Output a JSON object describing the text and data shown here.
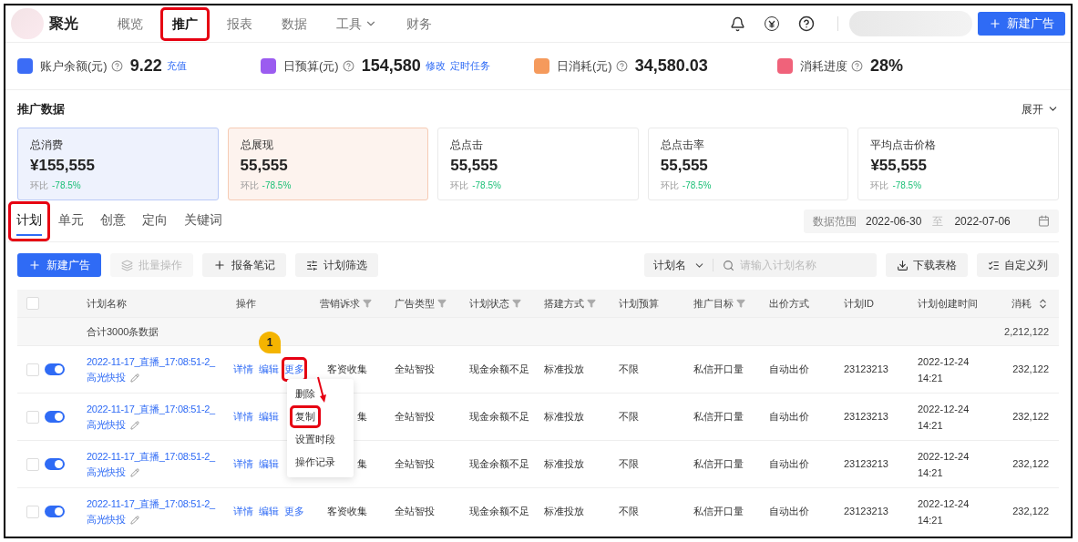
{
  "app": {
    "name": "聚光"
  },
  "nav": [
    {
      "label": "概览",
      "kind": "link",
      "selected": false,
      "highlighted": false
    },
    {
      "label": "推广",
      "kind": "link",
      "selected": true,
      "highlighted": true
    },
    {
      "label": "报表",
      "kind": "link",
      "selected": false,
      "highlighted": false
    },
    {
      "label": "数据",
      "kind": "link",
      "selected": false,
      "highlighted": false
    },
    {
      "label": "工具",
      "kind": "dropdown",
      "selected": false,
      "highlighted": false
    },
    {
      "label": "财务",
      "kind": "link",
      "selected": false,
      "highlighted": false
    }
  ],
  "header_button": "新建广告",
  "stats": [
    {
      "label": "账户余额(元)",
      "value": "9.22",
      "links": [
        "充值"
      ],
      "color": "#3b6cf6"
    },
    {
      "label": "日预算(元)",
      "value": "154,580",
      "links": [
        "修改",
        "定时任务"
      ],
      "color": "#9b5cf0"
    },
    {
      "label": "日消耗(元)",
      "value": "34,580.03",
      "color": "#f59a5c"
    },
    {
      "label": "消耗进度",
      "value": "28%",
      "color": "#f0627a"
    }
  ],
  "section": {
    "title": "推广数据",
    "toggle": "展开"
  },
  "cards": [
    {
      "label": "总消费",
      "value": "¥155,555",
      "change_label": "环比",
      "change": "-78.5%",
      "kind": "blue"
    },
    {
      "label": "总展现",
      "value": "55,555",
      "change_label": "环比",
      "change": "-78.5%",
      "kind": "orange"
    },
    {
      "label": "总点击",
      "value": "55,555",
      "change_label": "环比",
      "change": "-78.5%",
      "kind": "plain"
    },
    {
      "label": "总点击率",
      "value": "55,555",
      "change_label": "环比",
      "change": "-78.5%",
      "kind": "plain"
    },
    {
      "label": "平均点击价格",
      "value": "¥55,555",
      "change_label": "环比",
      "change": "-78.5%",
      "kind": "plain"
    }
  ],
  "tabs": [
    {
      "label": "计划",
      "selected": true,
      "highlighted": true
    },
    {
      "label": "单元",
      "selected": false,
      "highlighted": false
    },
    {
      "label": "创意",
      "selected": false,
      "highlighted": false
    },
    {
      "label": "定向",
      "selected": false,
      "highlighted": false
    },
    {
      "label": "关键词",
      "selected": false,
      "highlighted": false
    }
  ],
  "date_range": {
    "label": "数据范围",
    "start": "2022-06-30",
    "separator": "至",
    "end": "2022-07-06"
  },
  "toolbar": {
    "buttons": [
      {
        "label": "新建广告",
        "kind": "primary",
        "disabled": false
      },
      {
        "label": "批量操作",
        "kind": "batch",
        "disabled": true
      },
      {
        "label": "报备笔记",
        "kind": "add",
        "disabled": false
      },
      {
        "label": "计划筛选",
        "kind": "filter",
        "disabled": false
      }
    ],
    "search_scope": "计划名",
    "search_placeholder": "请输入计划名称",
    "download": "下载表格",
    "columns_button": "自定义列"
  },
  "table": {
    "header_checkbox": {
      "checked": false
    },
    "columns": [
      {
        "label": "计划名称",
        "kind": "plain"
      },
      {
        "label": "操作",
        "kind": "plain"
      },
      {
        "label": "营销诉求",
        "kind": "filter"
      },
      {
        "label": "广告类型",
        "kind": "filter"
      },
      {
        "label": "计划状态",
        "kind": "filter"
      },
      {
        "label": "搭建方式",
        "kind": "filter"
      },
      {
        "label": "计划预算",
        "kind": "plain"
      },
      {
        "label": "推广目标",
        "kind": "filter"
      },
      {
        "label": "出价方式",
        "kind": "plain"
      },
      {
        "label": "计划ID",
        "kind": "plain"
      },
      {
        "label": "计划创建时间",
        "kind": "plain"
      },
      {
        "label": "消耗",
        "kind": "sort"
      }
    ],
    "summary": {
      "label": "合计3000条数据",
      "spend": "2,212,122"
    },
    "rows": [
      {
        "checked": false,
        "on": true,
        "name": "2022-11-17_直播_17:08:51-2_高光快投",
        "actions": [
          {
            "label": "详情",
            "highlighted": false
          },
          {
            "label": "编辑",
            "highlighted": false
          },
          {
            "label": "更多",
            "highlighted": true
          }
        ],
        "appeal": "客资收集",
        "ad_type": "全站智投",
        "status": "现金余额不足",
        "build": "标准投放",
        "budget": "不限",
        "target": "私信开口量",
        "bid": "自动出价",
        "id": "23123213",
        "created": "2022-12-24 14:21",
        "spend": "232,122"
      },
      {
        "checked": false,
        "on": true,
        "name": "2022-11-17_直播_17:08:51-2_高光快投",
        "actions": [
          {
            "label": "详情",
            "highlighted": false
          },
          {
            "label": "编辑",
            "highlighted": false
          }
        ],
        "appeal": "集",
        "ad_type": "全站智投",
        "status": "现金余额不足",
        "build": "标准投放",
        "budget": "不限",
        "target": "私信开口量",
        "bid": "自动出价",
        "id": "23123213",
        "created": "2022-12-24 14:21",
        "spend": "232,122"
      },
      {
        "checked": false,
        "on": true,
        "name": "2022-11-17_直播_17:08:51-2_高光快投",
        "actions": [
          {
            "label": "详情",
            "highlighted": false
          },
          {
            "label": "编辑",
            "highlighted": false
          }
        ],
        "appeal": "集",
        "ad_type": "全站智投",
        "status": "现金余额不足",
        "build": "标准投放",
        "budget": "不限",
        "target": "私信开口量",
        "bid": "自动出价",
        "id": "23123213",
        "created": "2022-12-24 14:21",
        "spend": "232,122"
      },
      {
        "checked": false,
        "on": true,
        "name": "2022-11-17_直播_17:08:51-2_高光快投",
        "actions": [
          {
            "label": "详情",
            "highlighted": false
          },
          {
            "label": "编辑",
            "highlighted": false
          },
          {
            "label": "更多",
            "highlighted": false
          }
        ],
        "appeal": "客资收集",
        "ad_type": "全站智投",
        "status": "现金余额不足",
        "build": "标准投放",
        "budget": "不限",
        "target": "私信开口量",
        "bid": "自动出价",
        "id": "23123213",
        "created": "2022-12-24 14:21",
        "spend": "232,122"
      }
    ]
  },
  "menu": {
    "items": [
      {
        "label": "删除",
        "highlighted": false
      },
      {
        "label": "复制",
        "highlighted": true
      },
      {
        "label": "设置时段",
        "highlighted": false
      },
      {
        "label": "操作记录",
        "highlighted": false
      }
    ]
  },
  "callout": {
    "label": "1"
  }
}
